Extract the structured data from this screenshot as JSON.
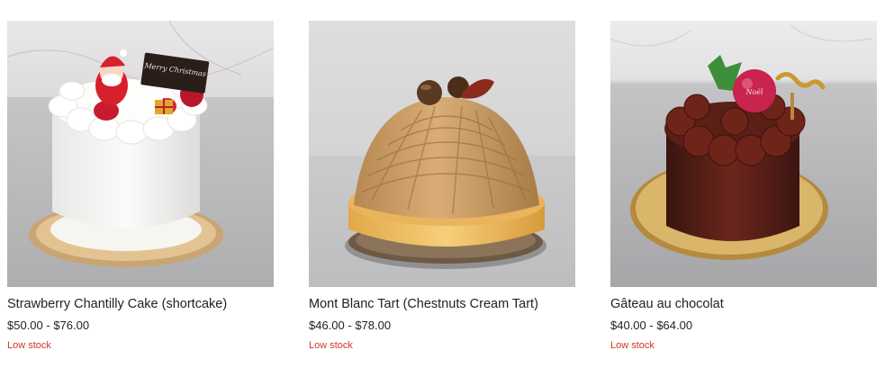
{
  "colors": {
    "stock_warning": "#d0342c",
    "text": "#222222"
  },
  "products": [
    {
      "title": "Strawberry Chantilly Cake (shortcake)",
      "price": "$50.00 - $76.00",
      "stock": "Low stock",
      "image": "strawberry-chantilly-cake-image",
      "image_text": "Merry Christmas"
    },
    {
      "title": "Mont Blanc Tart (Chestnuts Cream Tart)",
      "price": "$46.00 - $78.00",
      "stock": "Low stock",
      "image": "mont-blanc-tart-image"
    },
    {
      "title": "Gâteau au chocolat",
      "price": "$40.00 - $64.00",
      "stock": "Low stock",
      "image": "gateau-au-chocolat-image",
      "image_text": "Noël"
    }
  ]
}
